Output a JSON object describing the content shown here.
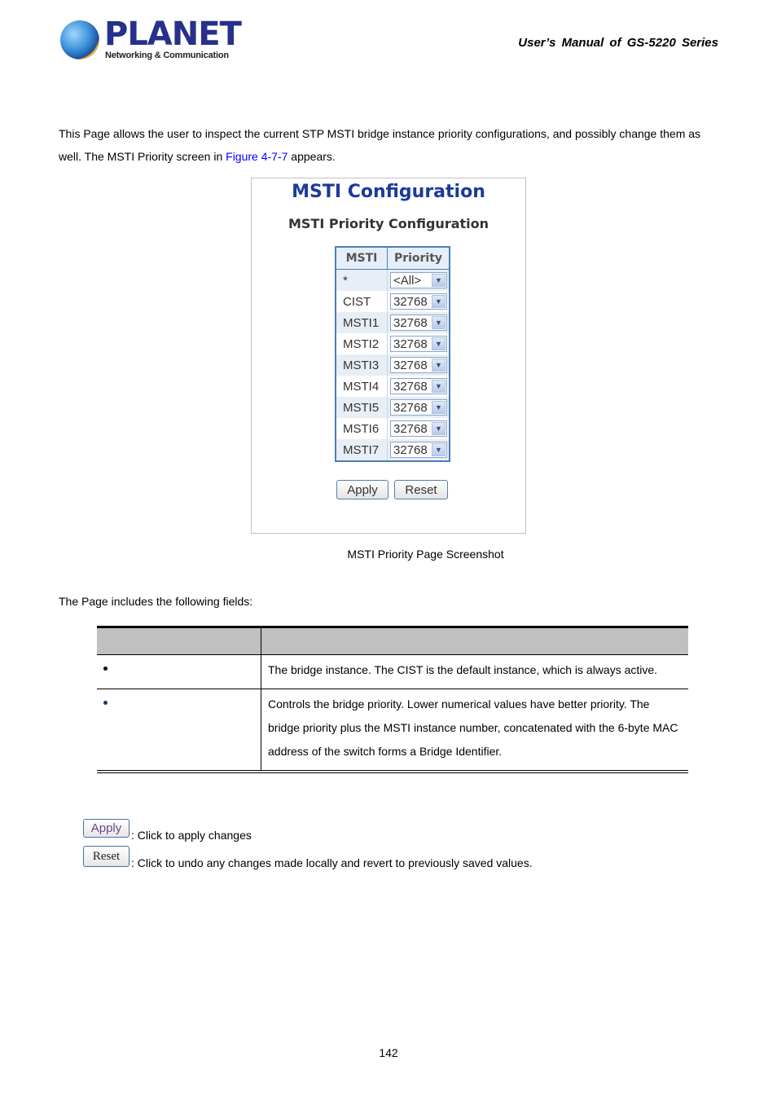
{
  "header": {
    "logo": {
      "brand": "PLANET",
      "tagline": "Networking & Communication",
      "icon": "planet-globe-icon"
    },
    "manual_title": "User’s  Manual  of  GS-5220  Series"
  },
  "intro": {
    "line1": "This Page allows the user to inspect the current STP MSTI bridge instance priority configurations, and possibly change them as",
    "line2_pre": "well. The MSTI Priority screen in ",
    "link": "Figure 4-7-7",
    "line2_post": " appears."
  },
  "screenshot": {
    "title": "MSTI Configuration",
    "subtitle": "MSTI Priority Configuration",
    "columns": [
      "MSTI",
      "Priority"
    ],
    "rows": [
      {
        "msti": "*",
        "priority": "<All>"
      },
      {
        "msti": "CIST",
        "priority": "32768"
      },
      {
        "msti": "MSTI1",
        "priority": "32768"
      },
      {
        "msti": "MSTI2",
        "priority": "32768"
      },
      {
        "msti": "MSTI3",
        "priority": "32768"
      },
      {
        "msti": "MSTI4",
        "priority": "32768"
      },
      {
        "msti": "MSTI5",
        "priority": "32768"
      },
      {
        "msti": "MSTI6",
        "priority": "32768"
      },
      {
        "msti": "MSTI7",
        "priority": "32768"
      }
    ],
    "apply_label": "Apply",
    "reset_label": "Reset"
  },
  "caption": "MSTI Priority Page Screenshot",
  "fields_intro": "The Page includes the following fields:",
  "fields_table": {
    "header": [
      "",
      ""
    ],
    "rows": [
      {
        "object": "",
        "description": "The bridge instance. The CIST is the default instance, which is always active."
      },
      {
        "object": "",
        "description": "Controls the bridge priority. Lower numerical values have better priority. The bridge priority plus the MSTI instance number, concatenated with the 6-byte MAC address of the switch forms a Bridge Identifier."
      }
    ]
  },
  "buttons_help": [
    {
      "label": "Apply",
      "description": ": Click to apply changes"
    },
    {
      "label": "Reset",
      "description": ": Click to undo any changes made locally and revert to previously saved values."
    }
  ],
  "page_number": "142"
}
